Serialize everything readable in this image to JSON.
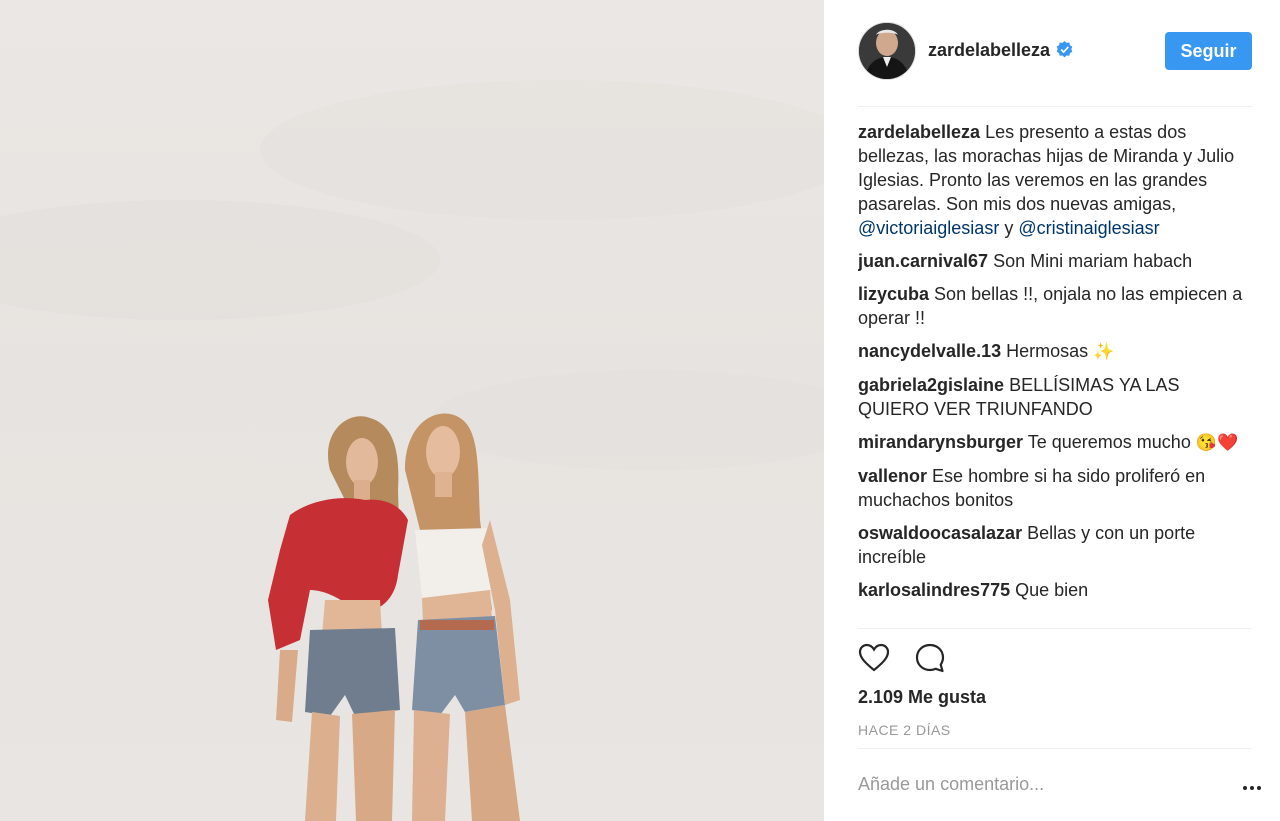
{
  "header": {
    "username": "zardelabelleza",
    "follow_label": "Seguir"
  },
  "caption": {
    "username": "zardelabelleza",
    "text": "Les presento a estas dos bellezas, las morachas hijas de Miranda y Julio Iglesias. Pronto las veremos en las grandes pasarelas. Son mis dos nuevas amigas,",
    "mention1": "@victoriaiglesiasr",
    "connector": "y",
    "mention2": "@cristinaiglesiasr"
  },
  "comments": [
    {
      "user": "juan.carnival67",
      "text": "Son Mini mariam habach"
    },
    {
      "user": "lizycuba",
      "text": "Son bellas !!, onjala no las empiecen a operar !!"
    },
    {
      "user": "nancydelvalle.13",
      "text": "Hermosas",
      "emoji": "✨"
    },
    {
      "user": "gabriela2gislaine",
      "text": "BELLÍSIMAS YA LAS QUIERO VER TRIUNFANDO"
    },
    {
      "user": "mirandarynsburger",
      "text": "Te queremos mucho",
      "emoji": "😘❤️"
    },
    {
      "user": "vallenor",
      "text": "Ese hombre si ha sido proliferó en muchachos bonitos"
    },
    {
      "user": "oswaldoocasalazar",
      "text": "Bellas y con un porte increíble"
    },
    {
      "user": "karlosalindres775",
      "text": "Que bien"
    }
  ],
  "likes_text": "2.109 Me gusta",
  "time_text": "HACE 2 DÍAS",
  "add_comment_placeholder": "Añade un comentario...",
  "icons": {
    "like": "heart-icon",
    "comment": "comment-bubble-icon",
    "verified": "verified-badge-icon",
    "more": "more-options-icon"
  },
  "colors": {
    "accent": "#3897f0",
    "mention": "#003569",
    "muted": "#999999"
  }
}
